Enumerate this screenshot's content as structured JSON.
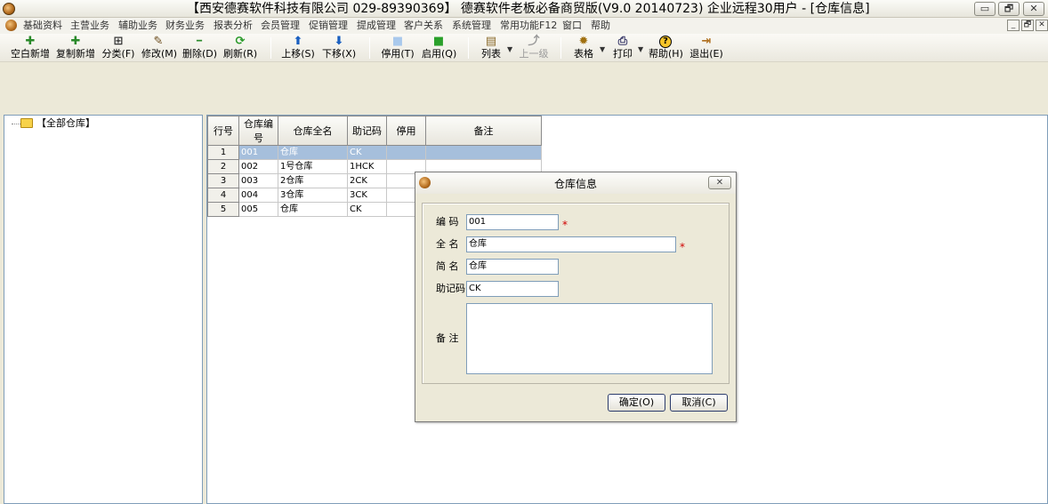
{
  "window": {
    "title": "【西安德赛软件科技有限公司 029-89390369】 德赛软件老板必备商贸版(V9.0 20140723) 企业远程30用户 - [仓库信息]",
    "minimize": "▭",
    "restore": "🗗",
    "close": "✕"
  },
  "menu": {
    "items": [
      "基础资料",
      "主营业务",
      "辅助业务",
      "财务业务",
      "报表分析",
      "会员管理",
      "促销管理",
      "提成管理",
      "客户关系",
      "系统管理",
      "常用功能F12",
      "窗口",
      "帮助"
    ],
    "mdi_minimize": "_",
    "mdi_restore": "🗗",
    "mdi_close": "✕"
  },
  "toolbar": {
    "buttons": [
      {
        "label": "空白新增",
        "icon": "plus-icon",
        "glyph": "✚",
        "color": "#2a8a2a"
      },
      {
        "label": "复制新增",
        "icon": "plus-icon",
        "glyph": "✚",
        "color": "#2a8a2a"
      },
      {
        "label": "分类(F)",
        "icon": "tree-icon",
        "glyph": "⊞",
        "color": "#333333"
      },
      {
        "label": "修改(M)",
        "icon": "edit-icon",
        "glyph": "✎",
        "color": "#6a4a1a"
      },
      {
        "label": "删除(D)",
        "icon": "minus-icon",
        "glyph": "━",
        "color": "#2a8a2a"
      },
      {
        "label": "刷新(R)",
        "icon": "refresh-icon",
        "glyph": "⟳",
        "color": "#2a9a2a"
      },
      {
        "label": "上移(S)",
        "icon": "arrow-up-icon",
        "glyph": "⬆",
        "color": "#1a5fc0"
      },
      {
        "label": "下移(X)",
        "icon": "arrow-down-icon",
        "glyph": "⬇",
        "color": "#1a5fc0"
      },
      {
        "label": "停用(T)",
        "icon": "stop-square-icon",
        "glyph": "■",
        "color": "#a9c9ec"
      },
      {
        "label": "启用(Q)",
        "icon": "start-square-icon",
        "glyph": "■",
        "color": "#2aa02a"
      },
      {
        "label": "列表",
        "icon": "list-icon",
        "glyph": "▤",
        "color": "#8a6a2a"
      },
      {
        "label": "上一级",
        "icon": "up-level-icon",
        "glyph": "⤴",
        "color": "#9a9a9a"
      },
      {
        "label": "表格",
        "icon": "table-gear-icon",
        "glyph": "✹",
        "color": "#a07010"
      },
      {
        "label": "打印",
        "icon": "printer-icon",
        "glyph": "⎙",
        "color": "#3a3a6a"
      },
      {
        "label": "帮助(H)",
        "icon": "help-icon",
        "glyph": "?",
        "color": "#000000"
      },
      {
        "label": "退出(E)",
        "icon": "exit-icon",
        "glyph": "⇥",
        "color": "#b07020"
      }
    ]
  },
  "tree": {
    "root_label": "【全部仓库】"
  },
  "grid": {
    "columns": [
      "行号",
      "仓库编号",
      "仓库全名",
      "助记码",
      "停用",
      "备注"
    ],
    "rows": [
      {
        "num": "1",
        "code": "001",
        "name": "仓库",
        "mnemonic": "CK",
        "disabled": "",
        "note": ""
      },
      {
        "num": "2",
        "code": "002",
        "name": "1号仓库",
        "mnemonic": "1HCK",
        "disabled": "",
        "note": ""
      },
      {
        "num": "3",
        "code": "003",
        "name": "2仓库",
        "mnemonic": "2CK",
        "disabled": "",
        "note": ""
      },
      {
        "num": "4",
        "code": "004",
        "name": "3仓库",
        "mnemonic": "3CK",
        "disabled": "",
        "note": ""
      },
      {
        "num": "5",
        "code": "005",
        "name": "仓库",
        "mnemonic": "CK",
        "disabled": "",
        "note": ""
      }
    ]
  },
  "dialog": {
    "title": "仓库信息",
    "close": "✕",
    "fields": {
      "code_label": "编 码",
      "code_value": "001",
      "fullname_label": "全 名",
      "fullname_value": "仓库",
      "shortname_label": "简 名",
      "shortname_value": "仓库",
      "mnemonic_label": "助记码",
      "mnemonic_value": "CK",
      "note_label": "备 注",
      "note_value": ""
    },
    "required_mark": "*",
    "ok_label": "确定(O)",
    "cancel_label": "取消(C)"
  }
}
